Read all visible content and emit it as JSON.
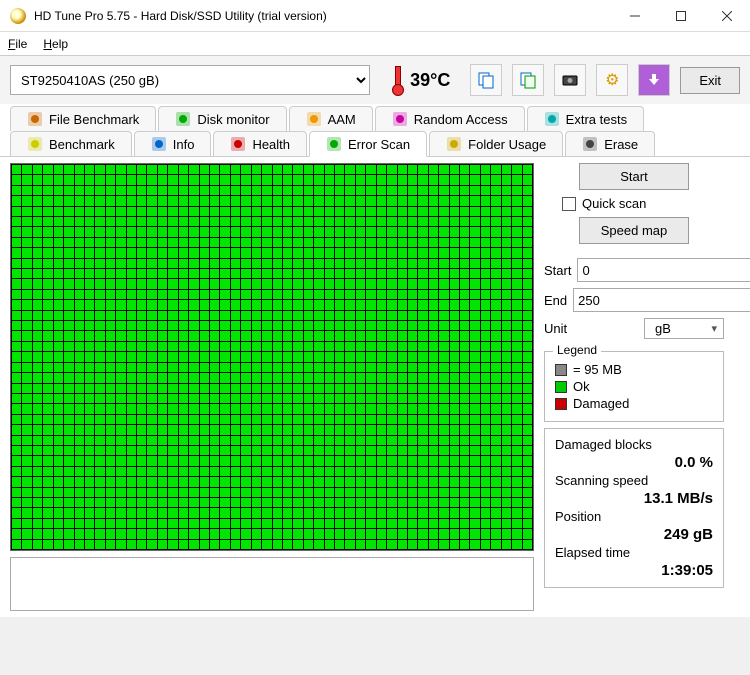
{
  "window": {
    "title": "HD Tune Pro 5.75 - Hard Disk/SSD Utility (trial version)"
  },
  "menu": {
    "file_html": "<u>F</u>ile",
    "help_html": "<u>H</u>elp"
  },
  "toolbar": {
    "drive": "ST9250410AS (250 gB)",
    "temperature": "39°C",
    "exit": "Exit"
  },
  "tabs_row1": [
    {
      "label": "File Benchmark",
      "icon": "file-benchmark-icon"
    },
    {
      "label": "Disk monitor",
      "icon": "disk-monitor-icon"
    },
    {
      "label": "AAM",
      "icon": "aam-icon"
    },
    {
      "label": "Random Access",
      "icon": "random-access-icon"
    },
    {
      "label": "Extra tests",
      "icon": "extra-tests-icon"
    }
  ],
  "tabs_row2": [
    {
      "label": "Benchmark",
      "icon": "benchmark-icon"
    },
    {
      "label": "Info",
      "icon": "info-icon"
    },
    {
      "label": "Health",
      "icon": "health-icon"
    },
    {
      "label": "Error Scan",
      "icon": "error-scan-icon",
      "active": true
    },
    {
      "label": "Folder Usage",
      "icon": "folder-usage-icon"
    },
    {
      "label": "Erase",
      "icon": "erase-icon"
    }
  ],
  "scan": {
    "start_button": "Start",
    "quick_scan": "Quick scan",
    "speed_map": "Speed map",
    "start_label": "Start",
    "start_value": "0",
    "end_label": "End",
    "end_value": "250",
    "unit_label": "Unit",
    "unit_value": "gB"
  },
  "legend": {
    "caption": "Legend",
    "block_size": "= 95 MB",
    "ok": "Ok",
    "damaged": "Damaged"
  },
  "stats": {
    "damaged_blocks_label": "Damaged blocks",
    "damaged_blocks_value": "0.0 %",
    "scanning_speed_label": "Scanning speed",
    "scanning_speed_value": "13.1 MB/s",
    "position_label": "Position",
    "position_value": "249 gB",
    "elapsed_label": "Elapsed time",
    "elapsed_value": "1:39:05"
  }
}
